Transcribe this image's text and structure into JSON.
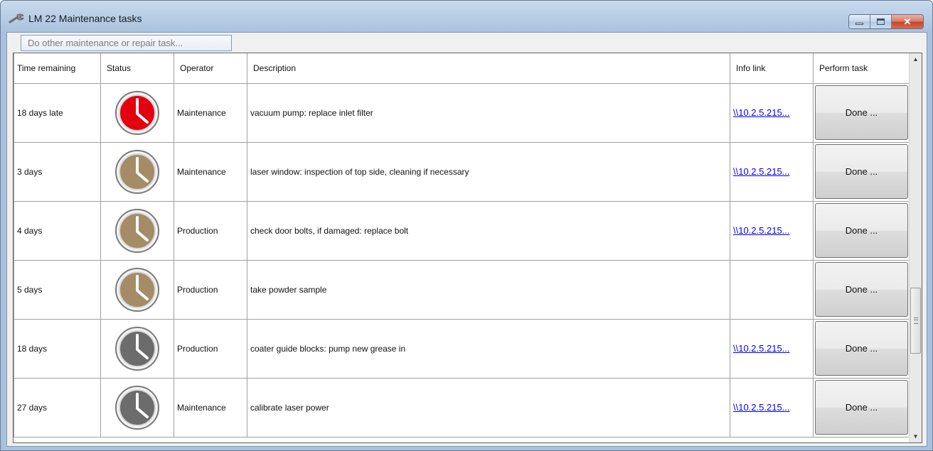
{
  "window": {
    "title": "LM 22 Maintenance tasks",
    "icon": "wrench-icon",
    "caption_buttons": [
      "minimize",
      "maximize",
      "close"
    ],
    "close_glyph": "✕"
  },
  "toolbar": {
    "other_task_label": "Do other maintenance or repair task..."
  },
  "table": {
    "headers": {
      "time": "Time remaining",
      "status": "Status",
      "operator": "Operator",
      "description": "Description",
      "info": "Info link",
      "perform": "Perform task"
    },
    "rows": [
      {
        "time": "18 days late",
        "status_icon": "clock-icon",
        "status_color": "#e3010f",
        "operator": "Maintenance",
        "description": "vacuum pump: replace inlet filter",
        "info_link": "\\\\10.2.5.215...",
        "perform": "Done ..."
      },
      {
        "time": "3 days",
        "status_icon": "clock-icon",
        "status_color": "#a48c66",
        "operator": "Maintenance",
        "description": "laser window: inspection of top side, cleaning if necessary",
        "info_link": "\\\\10.2.5.215...",
        "perform": "Done ..."
      },
      {
        "time": "4 days",
        "status_icon": "clock-icon",
        "status_color": "#a48c66",
        "operator": "Production",
        "description": "check door bolts, if damaged: replace bolt",
        "info_link": "\\\\10.2.5.215...",
        "perform": "Done ..."
      },
      {
        "time": "5 days",
        "status_icon": "clock-icon",
        "status_color": "#a48c66",
        "operator": "Production",
        "description": "take powder sample",
        "info_link": "",
        "perform": "Done ..."
      },
      {
        "time": "18 days",
        "status_icon": "clock-icon",
        "status_color": "#6c6c6c",
        "operator": "Production",
        "description": "coater guide blocks: pump new grease in",
        "info_link": "\\\\10.2.5.215...",
        "perform": "Done ..."
      },
      {
        "time": "27 days",
        "status_icon": "clock-icon",
        "status_color": "#6c6c6c",
        "operator": "Maintenance",
        "description": "calibrate laser power",
        "info_link": "\\\\10.2.5.215...",
        "perform": "Done ..."
      }
    ]
  },
  "scrollbar": {
    "up_glyph": "▲",
    "down_glyph": "▼"
  }
}
